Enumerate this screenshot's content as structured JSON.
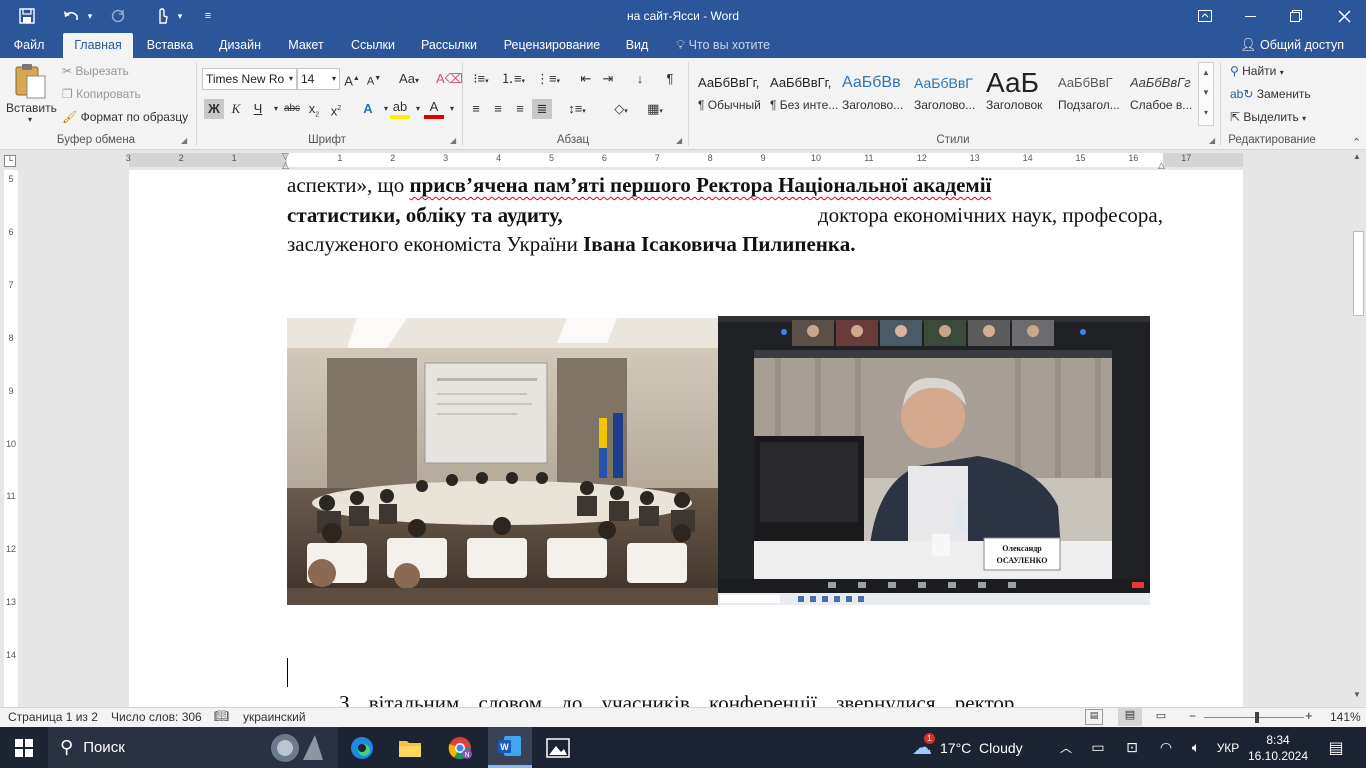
{
  "window": {
    "title": "на сайт-Ясси  -  Word",
    "share_label": "Общий доступ",
    "tell_me": "Что вы хотите сделать?"
  },
  "tabs": [
    "Файл",
    "Главная",
    "Вставка",
    "Дизайн",
    "Макет",
    "Ссылки",
    "Рассылки",
    "Рецензирование",
    "Вид"
  ],
  "clipboard": {
    "paste": "Вставить",
    "cut": "Вырезать",
    "copy": "Копировать",
    "format_painter": "Формат по образцу",
    "label": "Буфер обмена"
  },
  "font": {
    "name": "Times New Ro",
    "size": "14",
    "label": "Шрифт",
    "bold": "Ж",
    "italic": "К",
    "underline": "Ч",
    "strike": "abc"
  },
  "paragraph": {
    "label": "Абзац"
  },
  "styles": {
    "label": "Стили",
    "items": [
      {
        "sample": "АаБбВвГг,",
        "name": "¶ Обычный",
        "color": "#222222"
      },
      {
        "sample": "АаБбВвГг,",
        "name": "¶ Без инте...",
        "color": "#222222"
      },
      {
        "sample": "АаБбВв",
        "name": "Заголово...",
        "color": "#2e74b5"
      },
      {
        "sample": "АаБбВвГ",
        "name": "Заголово...",
        "color": "#2e74b5"
      },
      {
        "sample": "АаБ",
        "name": "Заголовок",
        "color": "#111111"
      },
      {
        "sample": "АаБбВвГ",
        "name": "Подзагол...",
        "color": "#595959"
      },
      {
        "sample": "АаБбВвГг",
        "name": "Слабое в...",
        "color": "#404040"
      }
    ]
  },
  "editing": {
    "label": "Редактирование",
    "find": "Найти",
    "replace": "Заменить",
    "select": "Выделить"
  },
  "ruler": {
    "h_ticks": [
      "3",
      "2",
      "1",
      "1",
      "2",
      "3",
      "4",
      "5",
      "6",
      "7",
      "8",
      "9",
      "10",
      "11",
      "12",
      "13",
      "14",
      "15",
      "16",
      "17"
    ],
    "v_ticks": [
      "5",
      "6",
      "7",
      "8",
      "9",
      "10",
      "11",
      "12",
      "13",
      "14"
    ]
  },
  "document": {
    "para1_line1_a": "аспекти», що ",
    "para1_line1_b": "присв’ячена пам’яті першого Ректора Національної академії",
    "para1_line2_a": "статистики, обліку та аудиту,",
    "para1_line2_b": " доктора економічних наук, професора,",
    "para1_line3_a": "заслуженого економіста України ",
    "para1_line3_b": "Івана Ісаковича Пилипенка.",
    "para2_line1": "З вітальним словом до учасників конференції звернулися ректор",
    "photo2_nameplate": "Олександр ОСАУЛЕНКО"
  },
  "status": {
    "page": "Страница 1 из 2",
    "words": "Число слов: 306",
    "language": "украинский",
    "zoom": "141%"
  },
  "taskbar": {
    "search": "Поиск",
    "weather": "17°C  Cloudy",
    "weather_badge": "1",
    "lang": "УКР",
    "time": "8:34",
    "date": "16.10.2024"
  },
  "colors": {
    "title_bar": "#2b579a",
    "ribbon": "#f3f3f3",
    "taskbar": "#1c2333"
  }
}
